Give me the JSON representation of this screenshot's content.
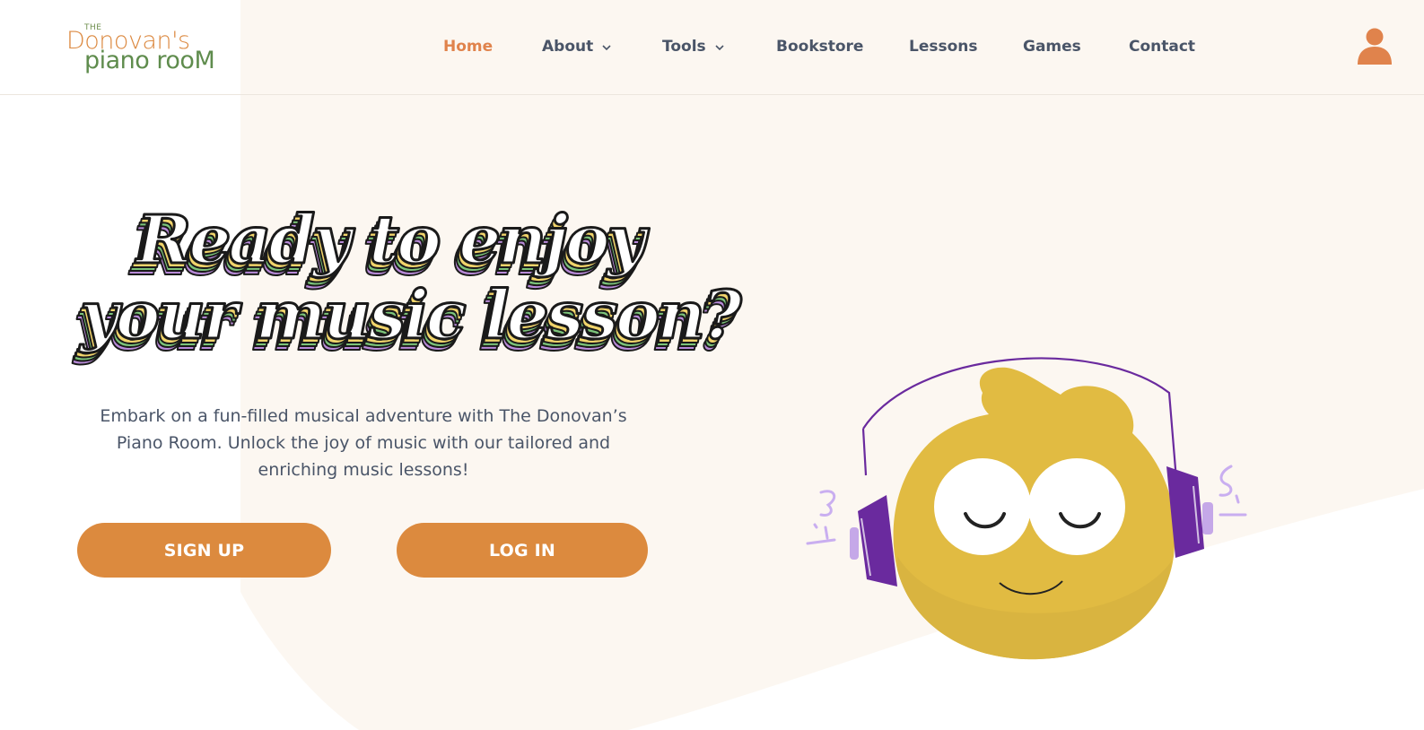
{
  "brand": {
    "logo_the": "THE",
    "logo_line1": "Donovan's",
    "logo_line2": "piano rooM"
  },
  "nav": {
    "items": [
      {
        "label": "Home",
        "active": true,
        "has_dropdown": false
      },
      {
        "label": "About",
        "active": false,
        "has_dropdown": true
      },
      {
        "label": "Tools",
        "active": false,
        "has_dropdown": true
      },
      {
        "label": "Bookstore",
        "active": false,
        "has_dropdown": false
      },
      {
        "label": "Lessons",
        "active": false,
        "has_dropdown": false
      },
      {
        "label": "Games",
        "active": false,
        "has_dropdown": false
      },
      {
        "label": "Contact",
        "active": false,
        "has_dropdown": false
      }
    ],
    "user_icon": "user-account-icon"
  },
  "hero": {
    "title_line1": "Ready to enjoy",
    "title_line2": "your music lesson?",
    "description": "Embark on a fun-filled musical adventure with The Donovan’s Piano Room. Unlock the joy of music with our tailored and enriching music lessons!",
    "signup_label": "SIGN UP",
    "login_label": "LOG IN"
  },
  "colors": {
    "accent": "#e0834c",
    "button": "#dc8a3e",
    "nav_text": "#4a5568",
    "background": "#fcf7f1",
    "mascot_body": "#e1bb42",
    "headphones": "#6a2a9e"
  }
}
